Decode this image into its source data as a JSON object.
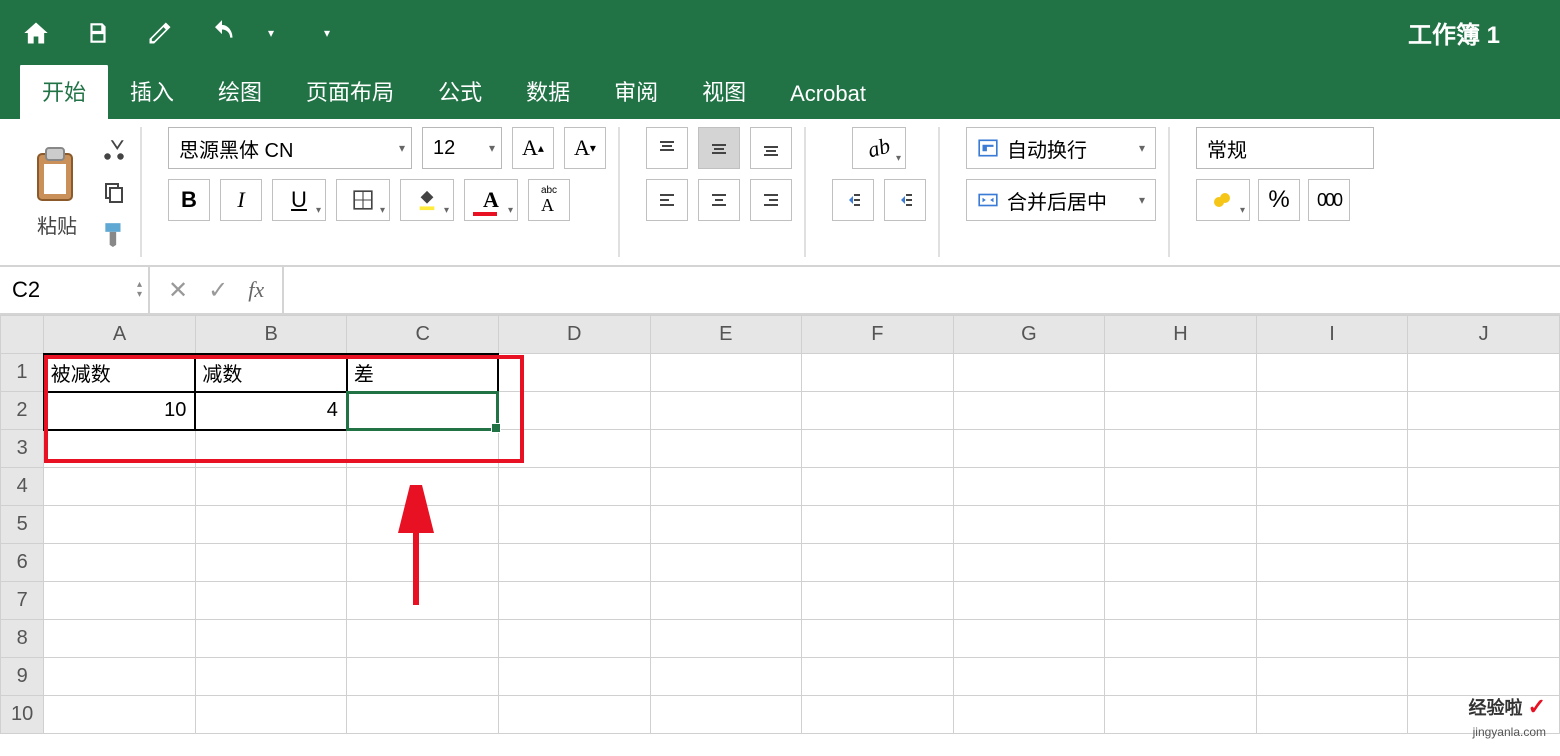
{
  "title": "工作簿 1",
  "tabs": [
    "开始",
    "插入",
    "绘图",
    "页面布局",
    "公式",
    "数据",
    "审阅",
    "视图",
    "Acrobat"
  ],
  "active_tab": 0,
  "clipboard": {
    "paste_label": "粘贴"
  },
  "font": {
    "name": "思源黑体 CN",
    "size": "12"
  },
  "wrap": {
    "auto_wrap": "自动换行",
    "merge_center": "合并后居中"
  },
  "number": {
    "format": "常规",
    "thousand": "000"
  },
  "name_box": "C2",
  "formula_fx": "fx",
  "columns": [
    "A",
    "B",
    "C",
    "D",
    "E",
    "F",
    "G",
    "H",
    "I",
    "J"
  ],
  "row_count": 10,
  "grid": {
    "A1": "被减数",
    "B1": "减数",
    "C1": "差",
    "A2": "10",
    "B2": "4"
  },
  "watermark": {
    "main": "经验啦",
    "domain": "jingyanla.com"
  }
}
